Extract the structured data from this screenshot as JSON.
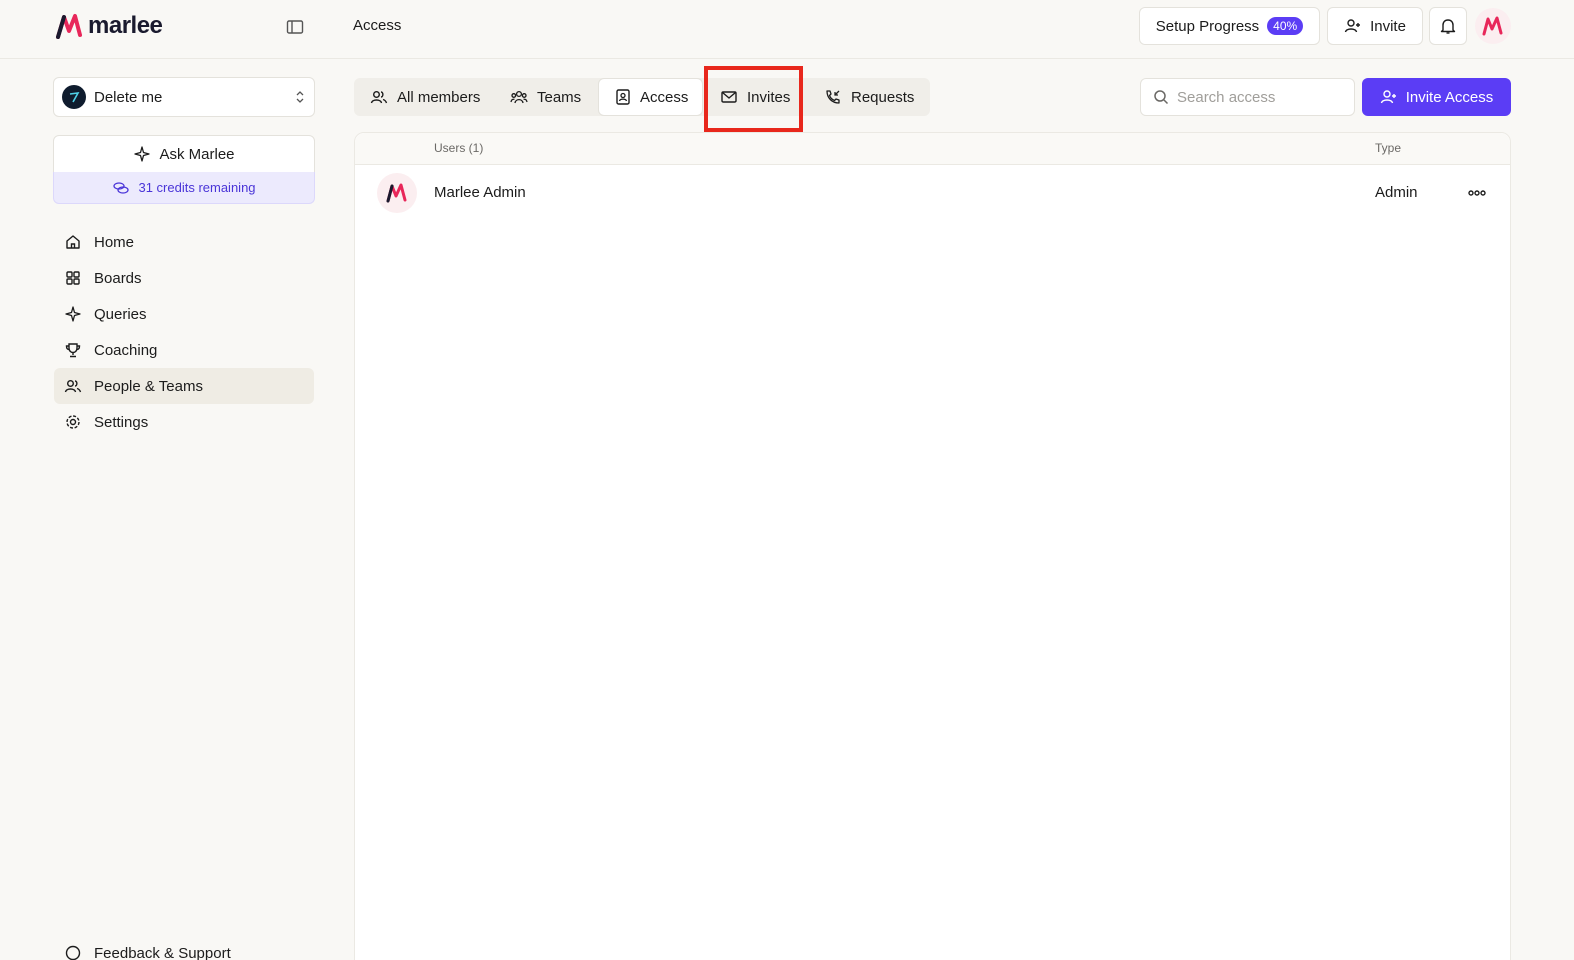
{
  "app": {
    "name": "marlee"
  },
  "header": {
    "breadcrumb": "Access",
    "setup_label": "Setup Progress",
    "setup_percent": "40%",
    "invite_label": "Invite"
  },
  "sidebar": {
    "workspace": "Delete me",
    "ask_label": "Ask Marlee",
    "credits": "31 credits remaining",
    "items": [
      {
        "label": "Home",
        "icon": "home-icon"
      },
      {
        "label": "Boards",
        "icon": "grid-icon"
      },
      {
        "label": "Queries",
        "icon": "sparkle-icon"
      },
      {
        "label": "Coaching",
        "icon": "trophy-icon"
      },
      {
        "label": "People & Teams",
        "icon": "people-icon"
      },
      {
        "label": "Settings",
        "icon": "gear-icon"
      }
    ],
    "footer": "Feedback & Support"
  },
  "tabs": [
    {
      "label": "All members",
      "icon": "users-icon"
    },
    {
      "label": "Teams",
      "icon": "team-icon"
    },
    {
      "label": "Access",
      "icon": "badge-icon"
    },
    {
      "label": "Invites",
      "icon": "mail-icon"
    },
    {
      "label": "Requests",
      "icon": "phone-incoming-icon"
    }
  ],
  "search": {
    "placeholder": "Search access"
  },
  "primary_action": "Invite Access",
  "table": {
    "columns": [
      "Users (1)",
      "Type"
    ],
    "rows": [
      {
        "name": "Marlee Admin",
        "type": "Admin"
      }
    ]
  },
  "colors": {
    "accent": "#5b3df5",
    "highlight": "#e8271c",
    "background": "#f9f8f5"
  }
}
